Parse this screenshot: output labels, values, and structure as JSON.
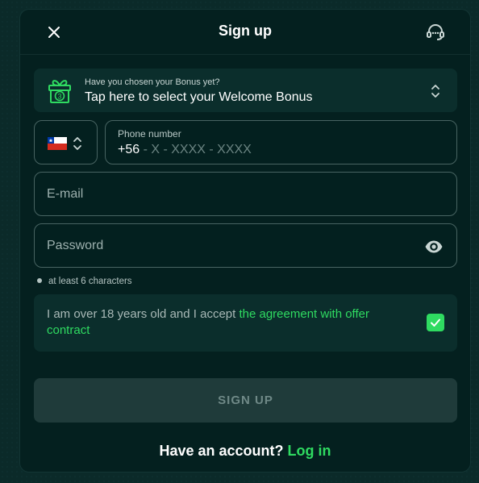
{
  "header": {
    "title": "Sign up",
    "close_icon": "close-icon",
    "support_icon": "headset-icon"
  },
  "bonus": {
    "subtitle": "Have you chosen your Bonus yet?",
    "label": "Tap here to select your Welcome Bonus",
    "icon": "gift-icon"
  },
  "phone": {
    "country_flag": "chile-flag",
    "label": "Phone number",
    "prefix": "+56",
    "mask": " - X - XXXX - XXXX"
  },
  "email": {
    "placeholder": "E-mail"
  },
  "password": {
    "placeholder": "Password",
    "hint": "at least 6 characters"
  },
  "agreement": {
    "text": "I am over 18 years old and I accept ",
    "link": "the agreement with offer contract",
    "checked": true
  },
  "signup_button": "SIGN UP",
  "footer": {
    "text": "Have an account? ",
    "login_link": "Log in"
  },
  "colors": {
    "accent": "#2fdb61",
    "background": "#04201f",
    "panel": "#0b2e2c"
  }
}
